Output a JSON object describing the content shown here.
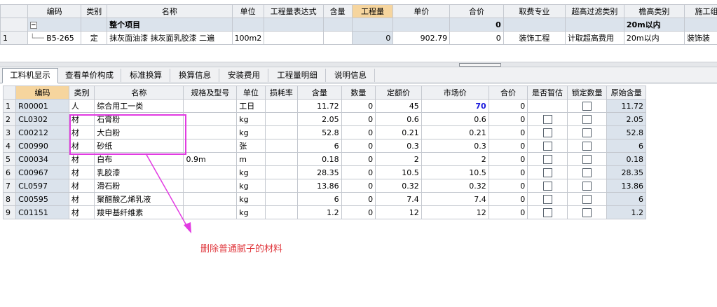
{
  "top_grid": {
    "headers": [
      "",
      "编码",
      "类别",
      "名称",
      "单位",
      "工程量表达式",
      "含量",
      "工程量",
      "单价",
      "合价",
      "取费专业",
      "超高过滤类别",
      "檐高类别",
      "施工组"
    ],
    "summary_row": {
      "toggle": "−",
      "name": "整个项目",
      "total": "0",
      "eave": "20m以内"
    },
    "rows": [
      {
        "rownum": "1",
        "code": "B5-265",
        "category": "定",
        "name": "抹灰面油漆 抹灰面乳胶漆 二遍",
        "unit": "100m2",
        "expr": "",
        "content": "",
        "qty": "0",
        "price": "902.79",
        "total": "0",
        "fee_major": "装饰工程",
        "filter": "计取超高费用",
        "eave": "20m以内",
        "group": "装饰装"
      }
    ]
  },
  "tabs": [
    {
      "label": "工料机显示",
      "active": true
    },
    {
      "label": "查看单价构成",
      "active": false
    },
    {
      "label": "标准换算",
      "active": false
    },
    {
      "label": "换算信息",
      "active": false
    },
    {
      "label": "安装费用",
      "active": false
    },
    {
      "label": "工程量明细",
      "active": false
    },
    {
      "label": "说明信息",
      "active": false
    }
  ],
  "bottom_grid": {
    "headers": [
      "",
      "编码",
      "类别",
      "名称",
      "规格及型号",
      "单位",
      "损耗率",
      "含量",
      "数量",
      "定额价",
      "市场价",
      "合价",
      "是否暂估",
      "锁定数量",
      "原始含量"
    ],
    "rows": [
      {
        "n": "1",
        "code": "R00001",
        "cat": "人",
        "name": "综合用工一类",
        "spec": "",
        "unit": "工日",
        "loss": "",
        "content": "11.72",
        "qty": "0",
        "quota": "45",
        "market": "70",
        "total": "0",
        "est": false,
        "lock": true,
        "orig": "11.72"
      },
      {
        "n": "2",
        "code": "CL0302",
        "cat": "材",
        "name": "石膏粉",
        "spec": "",
        "unit": "kg",
        "loss": "",
        "content": "2.05",
        "qty": "0",
        "quota": "0.6",
        "market": "0.6",
        "total": "0",
        "est": true,
        "lock": true,
        "orig": "2.05"
      },
      {
        "n": "3",
        "code": "C00212",
        "cat": "材",
        "name": "大白粉",
        "spec": "",
        "unit": "kg",
        "loss": "",
        "content": "52.8",
        "qty": "0",
        "quota": "0.21",
        "market": "0.21",
        "total": "0",
        "est": true,
        "lock": true,
        "orig": "52.8"
      },
      {
        "n": "4",
        "code": "C00990",
        "cat": "材",
        "name": "砂纸",
        "spec": "",
        "unit": "张",
        "loss": "",
        "content": "6",
        "qty": "0",
        "quota": "0.3",
        "market": "0.3",
        "total": "0",
        "est": true,
        "lock": true,
        "orig": "6"
      },
      {
        "n": "5",
        "code": "C00034",
        "cat": "材",
        "name": "白布",
        "spec": "0.9m",
        "unit": "m",
        "loss": "",
        "content": "0.18",
        "qty": "0",
        "quota": "2",
        "market": "2",
        "total": "0",
        "est": true,
        "lock": true,
        "orig": "0.18"
      },
      {
        "n": "6",
        "code": "C00967",
        "cat": "材",
        "name": "乳胶漆",
        "spec": "",
        "unit": "kg",
        "loss": "",
        "content": "28.35",
        "qty": "0",
        "quota": "10.5",
        "market": "10.5",
        "total": "0",
        "est": true,
        "lock": true,
        "orig": "28.35"
      },
      {
        "n": "7",
        "code": "CL0597",
        "cat": "材",
        "name": "滑石粉",
        "spec": "",
        "unit": "kg",
        "loss": "",
        "content": "13.86",
        "qty": "0",
        "quota": "0.32",
        "market": "0.32",
        "total": "0",
        "est": true,
        "lock": true,
        "orig": "13.86"
      },
      {
        "n": "8",
        "code": "C00595",
        "cat": "材",
        "name": "聚醋酸乙烯乳液",
        "spec": "",
        "unit": "kg",
        "loss": "",
        "content": "6",
        "qty": "0",
        "quota": "7.4",
        "market": "7.4",
        "total": "0",
        "est": true,
        "lock": true,
        "orig": "6"
      },
      {
        "n": "9",
        "code": "C01151",
        "cat": "材",
        "name": "羧甲基纤维素",
        "spec": "",
        "unit": "kg",
        "loss": "",
        "content": "1.2",
        "qty": "0",
        "quota": "12",
        "market": "12",
        "total": "0",
        "est": true,
        "lock": true,
        "orig": "1.2"
      }
    ]
  },
  "annotation": {
    "text": "删除普通腻子的材料",
    "color": "#e23ae2"
  }
}
